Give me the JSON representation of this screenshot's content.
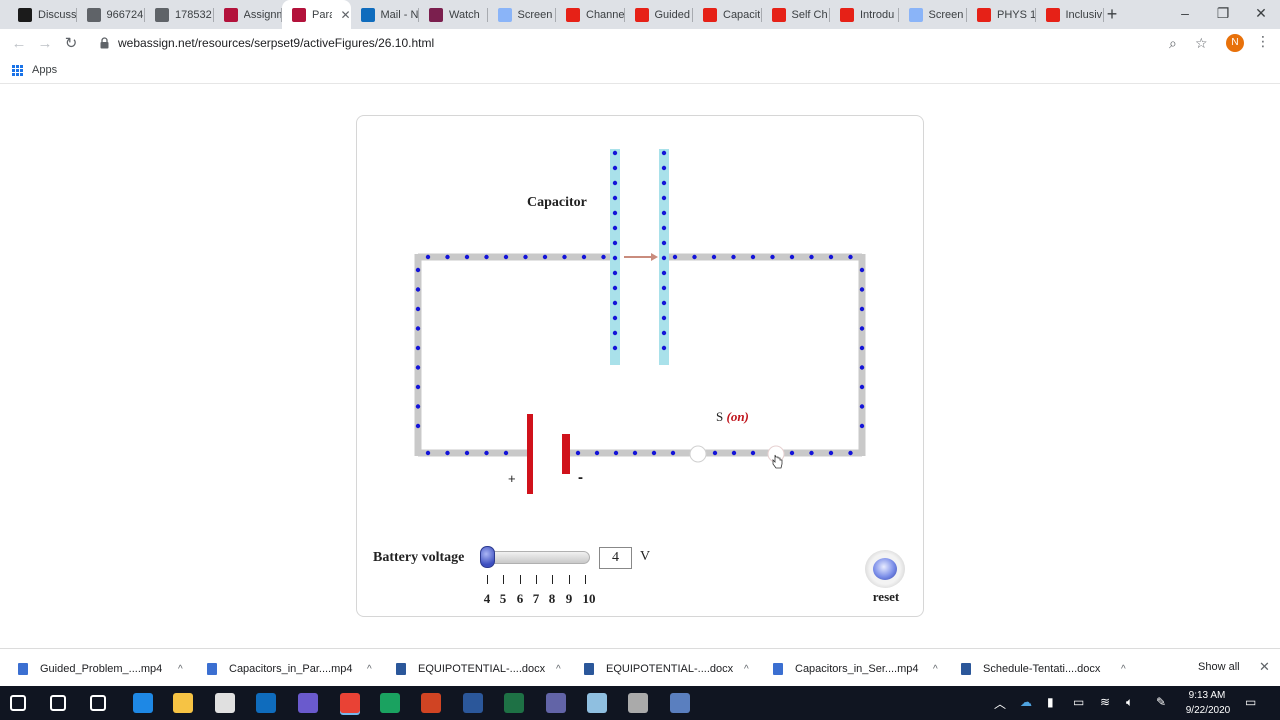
{
  "browser": {
    "tabs": [
      {
        "title": "Discuss",
        "icon": "blackboard-icon",
        "color": "#1b1b1b"
      },
      {
        "title": "966724",
        "icon": "globe-icon",
        "color": "#5f6368"
      },
      {
        "title": "178532",
        "icon": "globe-icon",
        "color": "#5f6368"
      },
      {
        "title": "Assignm",
        "icon": "webassign-icon",
        "color": "#b3123b"
      },
      {
        "title": "Para",
        "icon": "webassign-icon",
        "color": "#b3123b",
        "active": true
      },
      {
        "title": "Mail - N",
        "icon": "outlook-icon",
        "color": "#0f6cbd"
      },
      {
        "title": "Watch",
        "icon": "panopto-icon",
        "color": "#7b1f4e"
      },
      {
        "title": "Screen",
        "icon": "screencast-icon",
        "color": "#8ab4f8"
      },
      {
        "title": "Channe",
        "icon": "youtube-icon",
        "color": "#e62117"
      },
      {
        "title": "Guided",
        "icon": "youtube-icon",
        "color": "#e62117"
      },
      {
        "title": "Capacit",
        "icon": "youtube-icon",
        "color": "#e62117"
      },
      {
        "title": "Self Ch",
        "icon": "youtube-icon",
        "color": "#e62117"
      },
      {
        "title": "Introdu",
        "icon": "youtube-icon",
        "color": "#e62117"
      },
      {
        "title": "Screen",
        "icon": "screencast-icon",
        "color": "#8ab4f8"
      },
      {
        "title": "PHYS 1",
        "icon": "youtube-icon",
        "color": "#e62117"
      },
      {
        "title": "Inclusiv",
        "icon": "youtube-icon",
        "color": "#e62117"
      }
    ],
    "url": "webassign.net/resources/serpset9/activeFigures/26.10.html",
    "profile_initial": "N",
    "bookmarks": {
      "apps_label": "Apps"
    }
  },
  "simulation": {
    "capacitor_label": "Capacitor",
    "switch_label": "S",
    "switch_state": "(on)",
    "battery_plus": "+",
    "battery_minus": "-",
    "battery_voltage_label": "Battery voltage",
    "voltage_value": "4",
    "voltage_unit": "V",
    "voltage_ticks": [
      "4",
      "5",
      "6",
      "7",
      "8",
      "9",
      "10"
    ],
    "voltage_min": 4,
    "voltage_max": 10,
    "reset_label": "reset",
    "colors": {
      "wire": "#c9c9c9",
      "charge": "#1414d8",
      "plate": "#a9e1ea",
      "battery": "#d0121b",
      "arrow": "#c98c7d",
      "switch_state": "#c0141c"
    }
  },
  "downloads": [
    {
      "name": "Guided_Problem_....mp4",
      "type": "video",
      "color": "#3b6fd1"
    },
    {
      "name": "Capacitors_in_Par....mp4",
      "type": "video",
      "color": "#3b6fd1"
    },
    {
      "name": "EQUIPOTENTIAL-....docx",
      "type": "word",
      "color": "#2b579a"
    },
    {
      "name": "EQUIPOTENTIAL-....docx",
      "type": "word",
      "color": "#2b579a"
    },
    {
      "name": "Capacitors_in_Ser....mp4",
      "type": "video",
      "color": "#3b6fd1"
    },
    {
      "name": "Schedule-Tentati....docx",
      "type": "word",
      "color": "#2b579a"
    }
  ],
  "downloads_show_all": "Show all",
  "taskbar": {
    "time": "9:13 AM",
    "date": "9/22/2020",
    "apps": [
      {
        "name": "start-icon",
        "color": "#ffffff"
      },
      {
        "name": "search-icon",
        "color": "#ffffff"
      },
      {
        "name": "task-view-icon",
        "color": "#ffffff"
      },
      {
        "name": "edge-icon",
        "color": "#1e88e5"
      },
      {
        "name": "file-explorer-icon",
        "color": "#f6c344"
      },
      {
        "name": "store-icon",
        "color": "#e0e0e0"
      },
      {
        "name": "mail-icon",
        "color": "#0f6cbd"
      },
      {
        "name": "webassign-app-icon",
        "color": "#6a5acd"
      },
      {
        "name": "chrome-icon",
        "color": "#e94235",
        "active": true
      },
      {
        "name": "screencast-app-icon",
        "color": "#1aa260"
      },
      {
        "name": "powerpoint-icon",
        "color": "#d04423"
      },
      {
        "name": "word-icon",
        "color": "#2b579a"
      },
      {
        "name": "excel-icon",
        "color": "#1e7145"
      },
      {
        "name": "teams-icon",
        "color": "#6264a7"
      },
      {
        "name": "snip-icon",
        "color": "#8fbfe0"
      },
      {
        "name": "cloud-app-icon",
        "color": "#aaaaaa"
      },
      {
        "name": "recorder-icon",
        "color": "#5a7fbf"
      }
    ]
  }
}
